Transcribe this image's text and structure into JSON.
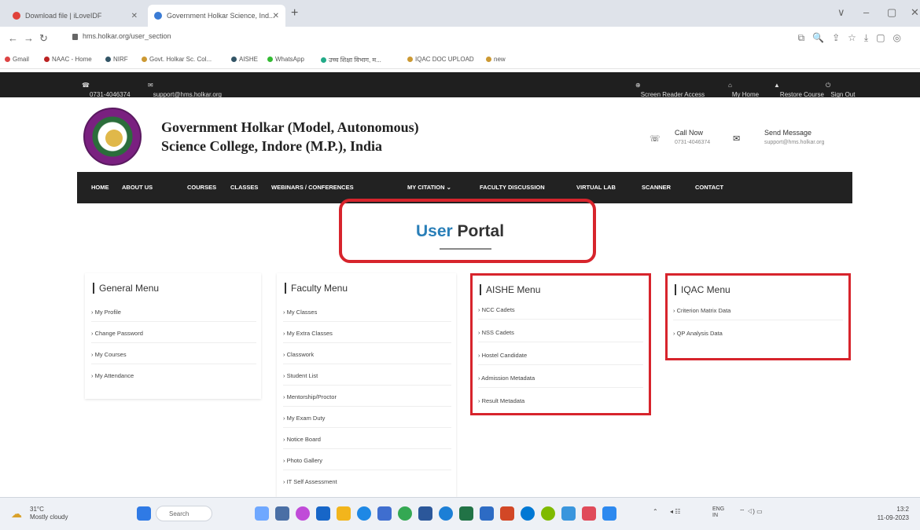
{
  "browser": {
    "tabs": [
      {
        "title": "Download file | iLoveIDF"
      },
      {
        "title": "Government Holkar Science, Ind..."
      }
    ],
    "new_tab": "+",
    "url": "hms.holkar.org/user_section",
    "window_controls": [
      "∨",
      "–",
      "▢",
      "✕"
    ],
    "bookmarks": [
      "Gmail",
      "NAAC - Home",
      "NIRF",
      "Govt. Holkar Sc. Col...",
      "AISHE",
      "WhatsApp",
      "उच्च शिक्षा विभाग, म...",
      "IQAC DOC UPLOAD",
      "new"
    ]
  },
  "topbar": {
    "phone": "0731-4046374",
    "email": "support@hms.holkar.org",
    "links": [
      "Screen Reader Access",
      "My Home",
      "Restore Course",
      "Sign Out"
    ]
  },
  "header": {
    "college_line1": "Government Holkar (Model, Autonomous)",
    "college_line2": "Science College, Indore (M.P.), India",
    "call_title": "Call Now",
    "call_number": "0731-4046374",
    "msg_title": "Send Message",
    "msg_email": "support@hms.holkar.org"
  },
  "nav": [
    "HOME",
    "ABOUT US",
    "COURSES",
    "CLASSES",
    "WEBINARS / CONFERENCES",
    "MY CITATION ⌄",
    "FACULTY DISCUSSION",
    "VIRTUAL LAB",
    "SCANNER",
    "CONTACT"
  ],
  "page": {
    "title_part1": "User",
    "title_part2": "Portal"
  },
  "menus": {
    "general": {
      "title": "General Menu",
      "items": [
        "› My Profile",
        "› Change Password",
        "› My Courses",
        "› My Attendance"
      ]
    },
    "faculty": {
      "title": "Faculty Menu",
      "items": [
        "› My Classes",
        "› My Extra Classes",
        "› Classwork",
        "› Student List",
        "› Mentorship/Proctor",
        "› My Exam Duty",
        "› Notice Board",
        "› Photo Gallery",
        "› IT Self Assessment"
      ]
    },
    "aishe": {
      "title": "AISHE Menu",
      "items": [
        "› NCC Cadets",
        "› NSS Cadets",
        "› Hostel Candidate",
        "› Admission Metadata",
        "› Result Metadata"
      ]
    },
    "iqac": {
      "title": "IQAC Menu",
      "items": [
        "› Criterion Matrix Data",
        "› QP Analysis Data"
      ]
    }
  },
  "taskbar": {
    "weather_temp": "31°C",
    "weather_text": "Mostly cloudy",
    "search": "Search",
    "lang": "ENG IN",
    "time": "13:2",
    "date": "11-09-2023"
  },
  "colors": {
    "accent_blue": "#2a7fb8",
    "highlight_red": "#d7242c",
    "nav_dark": "#222222"
  }
}
